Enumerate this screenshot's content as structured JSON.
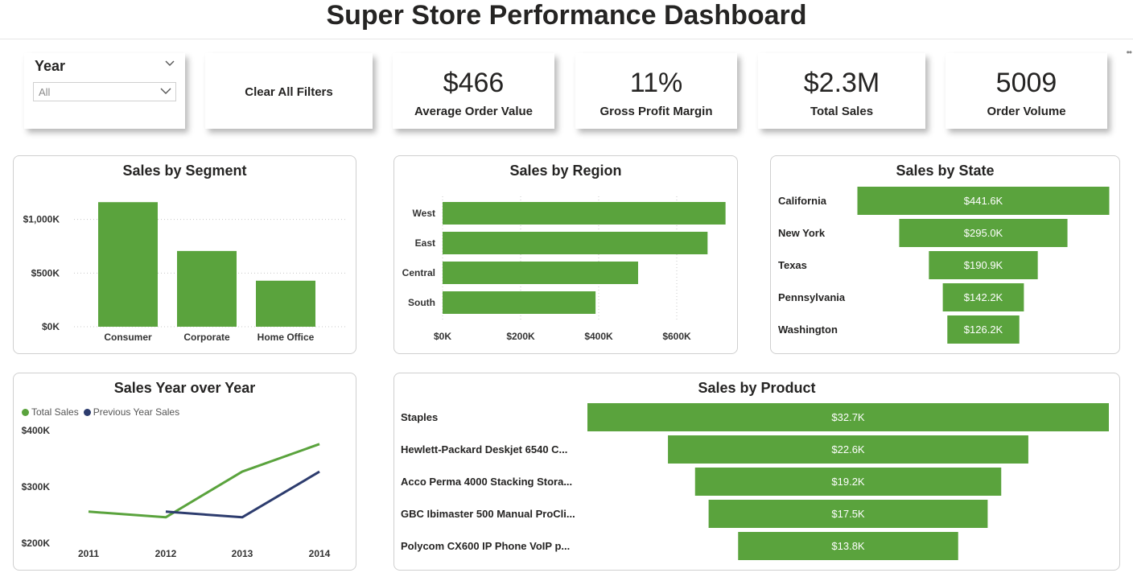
{
  "title": "Super Store Performance Dashboard",
  "colors": {
    "bar": "#5aa33d",
    "prev": "#2d3c6e",
    "grid": "#c8c8c8"
  },
  "slicer": {
    "label": "Year",
    "value": "All"
  },
  "clear_filters": "Clear All Filters",
  "kpis": [
    {
      "value": "$466",
      "label": "Average Order Value"
    },
    {
      "value": "11%",
      "label": "Gross Profit Margin"
    },
    {
      "value": "$2.3M",
      "label": "Total Sales"
    },
    {
      "value": "5009",
      "label": "Order Volume"
    }
  ],
  "chart_data": [
    {
      "id": "segment",
      "type": "bar",
      "title": "Sales by Segment",
      "categories": [
        "Consumer",
        "Corporate",
        "Home Office"
      ],
      "values": [
        1161,
        706,
        429
      ],
      "ylim": [
        0,
        1200
      ],
      "yticks": [
        0,
        500,
        1000
      ],
      "ytick_labels": [
        "$0K",
        "$500K",
        "$1,000K"
      ],
      "grid": true
    },
    {
      "id": "region",
      "type": "bar",
      "orientation": "horizontal",
      "title": "Sales by Region",
      "categories": [
        "West",
        "East",
        "Central",
        "South"
      ],
      "values": [
        725,
        679,
        501,
        392
      ],
      "xlim": [
        0,
        700
      ],
      "xticks": [
        0,
        200,
        400,
        600
      ],
      "xtick_labels": [
        "$0K",
        "$200K",
        "$400K",
        "$600K"
      ],
      "grid": true
    },
    {
      "id": "state",
      "type": "bar",
      "subtype": "funnel",
      "title": "Sales by State",
      "categories": [
        "California",
        "New York",
        "Texas",
        "Pennsylvania",
        "Washington"
      ],
      "values": [
        441.6,
        295.0,
        190.9,
        142.2,
        126.2
      ],
      "data_labels": [
        "$441.6K",
        "$295.0K",
        "$190.9K",
        "$142.2K",
        "$126.2K"
      ]
    },
    {
      "id": "yoy",
      "type": "line",
      "title": "Sales Year over Year",
      "x": [
        "2011",
        "2012",
        "2013",
        "2014"
      ],
      "series": [
        {
          "name": "Total Sales",
          "values": [
            256,
            246,
            327,
            376
          ]
        },
        {
          "name": "Previous Year Sales",
          "values": [
            null,
            256,
            246,
            327
          ]
        }
      ],
      "ylim": [
        200,
        400
      ],
      "yticks": [
        200,
        300,
        400
      ],
      "ytick_labels": [
        "$200K",
        "$300K",
        "$400K"
      ],
      "legend": "top-left"
    },
    {
      "id": "product",
      "type": "bar",
      "subtype": "funnel",
      "title": "Sales by Product",
      "categories": [
        "Staples",
        "Hewlett-Packard Deskjet 6540 C...",
        "Acco Perma 4000 Stacking Stora...",
        "GBC Ibimaster 500 Manual ProCli...",
        "Polycom CX600 IP Phone VoIP p..."
      ],
      "values": [
        32.7,
        22.6,
        19.2,
        17.5,
        13.8
      ],
      "data_labels": [
        "$32.7K",
        "$22.6K",
        "$19.2K",
        "$17.5K",
        "$13.8K"
      ]
    }
  ]
}
